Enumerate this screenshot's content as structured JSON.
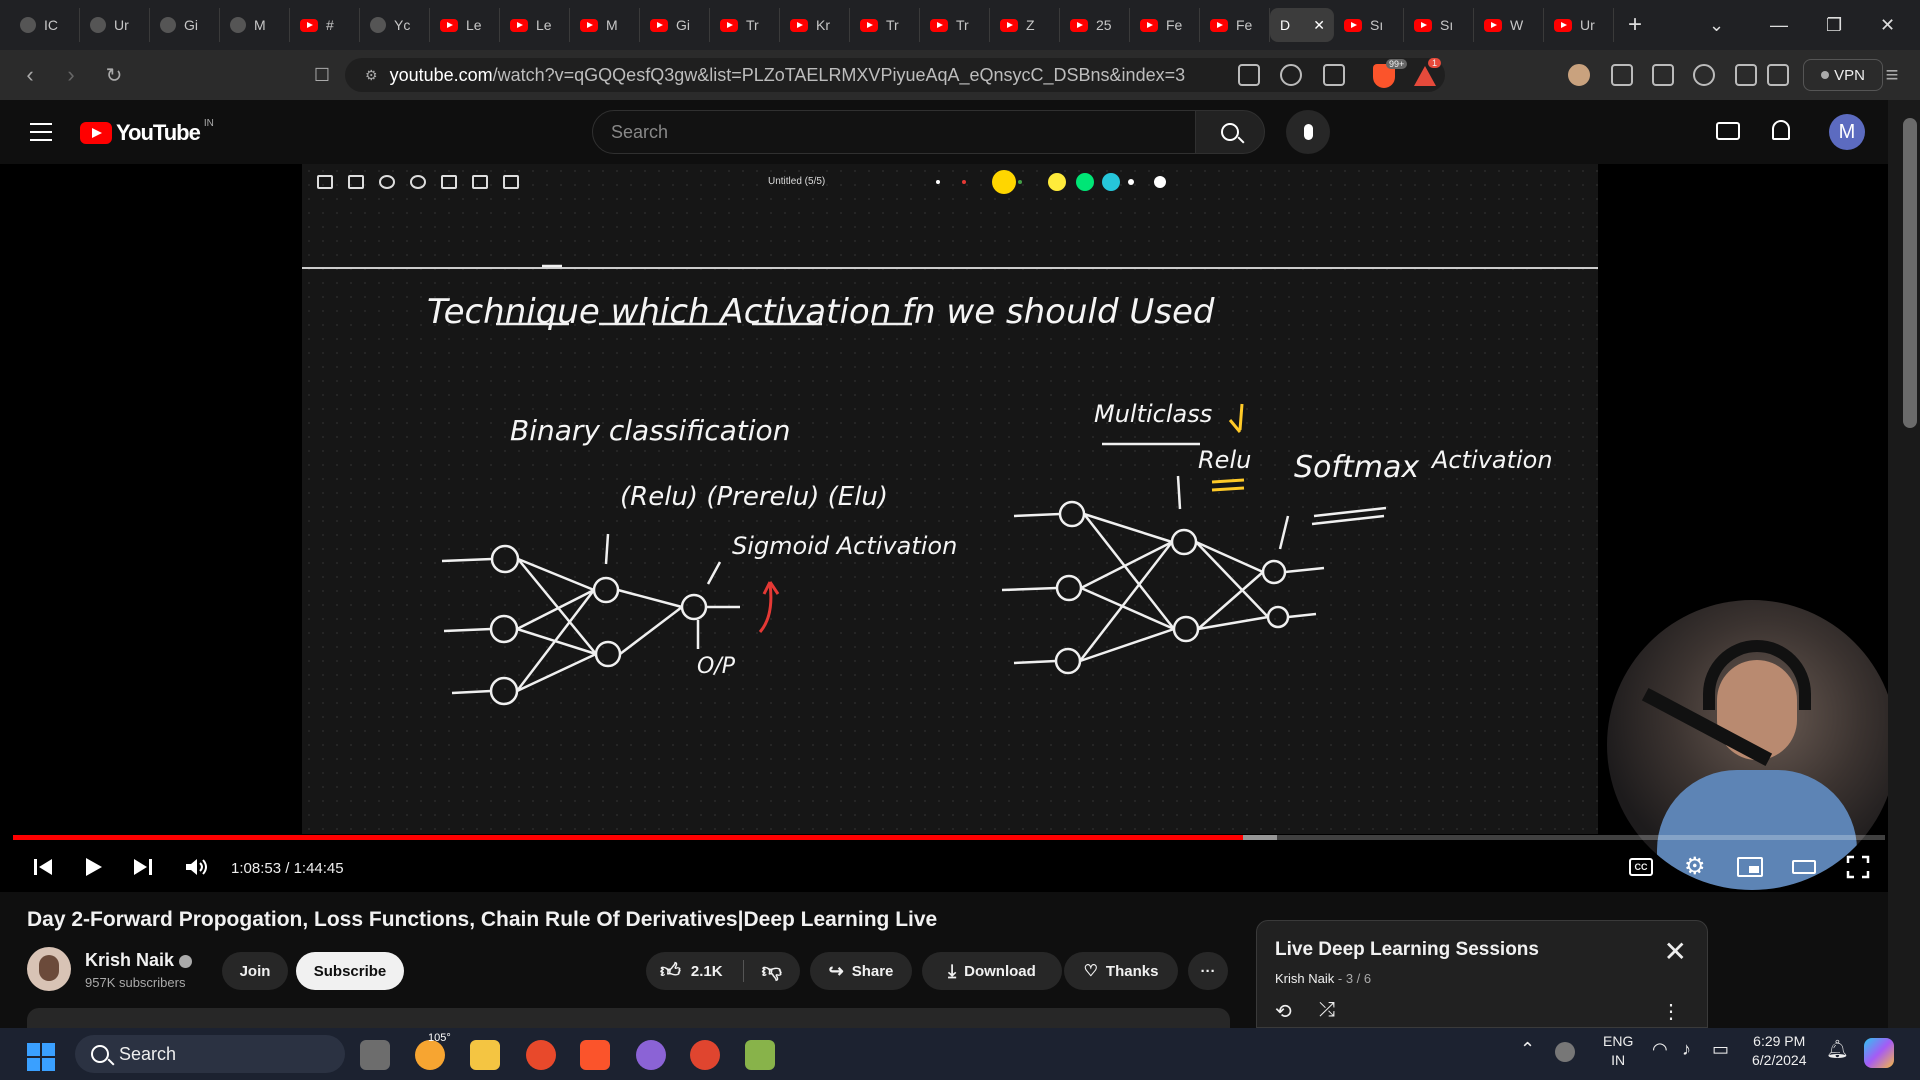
{
  "browser": {
    "tabs": [
      {
        "label": "IC",
        "icon": "chatgpt-icon"
      },
      {
        "label": "Ur",
        "icon": "docs-icon"
      },
      {
        "label": "Gi",
        "icon": "gemini-icon"
      },
      {
        "label": "M",
        "icon": "link-icon"
      },
      {
        "label": "#",
        "icon": "youtube-icon"
      },
      {
        "label": "Yc",
        "icon": "music-icon"
      },
      {
        "label": "Le",
        "icon": "youtube-icon"
      },
      {
        "label": "Le",
        "icon": "youtube-icon"
      },
      {
        "label": "M",
        "icon": "youtube-icon"
      },
      {
        "label": "Gi",
        "icon": "youtube-icon"
      },
      {
        "label": "Tr",
        "icon": "youtube-icon"
      },
      {
        "label": "Kr",
        "icon": "youtube-icon"
      },
      {
        "label": "Tr",
        "icon": "youtube-icon"
      },
      {
        "label": "Tr",
        "icon": "youtube-icon"
      },
      {
        "label": "Z",
        "icon": "youtube-icon"
      },
      {
        "label": "25",
        "icon": "youtube-icon"
      },
      {
        "label": "Fe",
        "icon": "youtube-icon"
      },
      {
        "label": "Fe",
        "icon": "youtube-icon"
      }
    ],
    "active_tab": {
      "label": "D"
    },
    "tabs_after": [
      {
        "label": "Sı",
        "icon": "youtube-icon"
      },
      {
        "label": "Sı",
        "icon": "youtube-icon"
      },
      {
        "label": "W",
        "icon": "youtube-icon"
      },
      {
        "label": "Ur",
        "icon": "youtube-icon"
      }
    ],
    "url_host": "youtube.com",
    "url_path": "/watch?v=qGQQesfQ3gw&list=PLZoTAELRMXVPiyueAqA_eQnsycC_DSBns&index=3",
    "shield_badge": "99+",
    "alert_badge": "1",
    "vpn_label": "VPN"
  },
  "youtube": {
    "logo_text": "YouTube",
    "country": "IN",
    "search_placeholder": "Search",
    "avatar_letter": "M"
  },
  "board": {
    "title": "Untitled (5/5)",
    "colors": [
      "#ffffff",
      "#e53935",
      "#ffd600",
      "#43a047",
      "#ffeb3b",
      "#00e676",
      "#26c6da",
      "#ffffff",
      "#ffffff"
    ],
    "heading": "Technique   which   Activation   fn   we  should   Used",
    "left_title": "Binary   classification",
    "left_acts": "(Relu)   (Prerelu) (Elu)",
    "sigmoid": "Sigmoid  Activation",
    "op": "O/P",
    "right_title": "Multiclass",
    "relu": "Relu",
    "softmax": "Softmax",
    "activation": "Activation"
  },
  "player": {
    "time_current": "1:08:53",
    "time_total": "1:44:45",
    "progress": 0.657,
    "buffered": 0.675
  },
  "video": {
    "title": "Day 2-Forward Propogation, Loss Functions, Chain Rule Of Derivatives|Deep Learning Live",
    "channel": "Krish Naik",
    "subscribers": "957K subscribers",
    "join": "Join",
    "subscribe": "Subscribe",
    "likes": "2.1K",
    "share": "Share",
    "download": "Download",
    "thanks": "Thanks"
  },
  "playlist": {
    "title": "Live Deep Learning Sessions",
    "channel": "Krish Naik",
    "position": "3 / 6"
  },
  "taskbar": {
    "search": "Search",
    "weather": "105°",
    "lang1": "ENG",
    "lang2": "IN",
    "time": "6:29 PM",
    "date": "6/2/2024"
  }
}
